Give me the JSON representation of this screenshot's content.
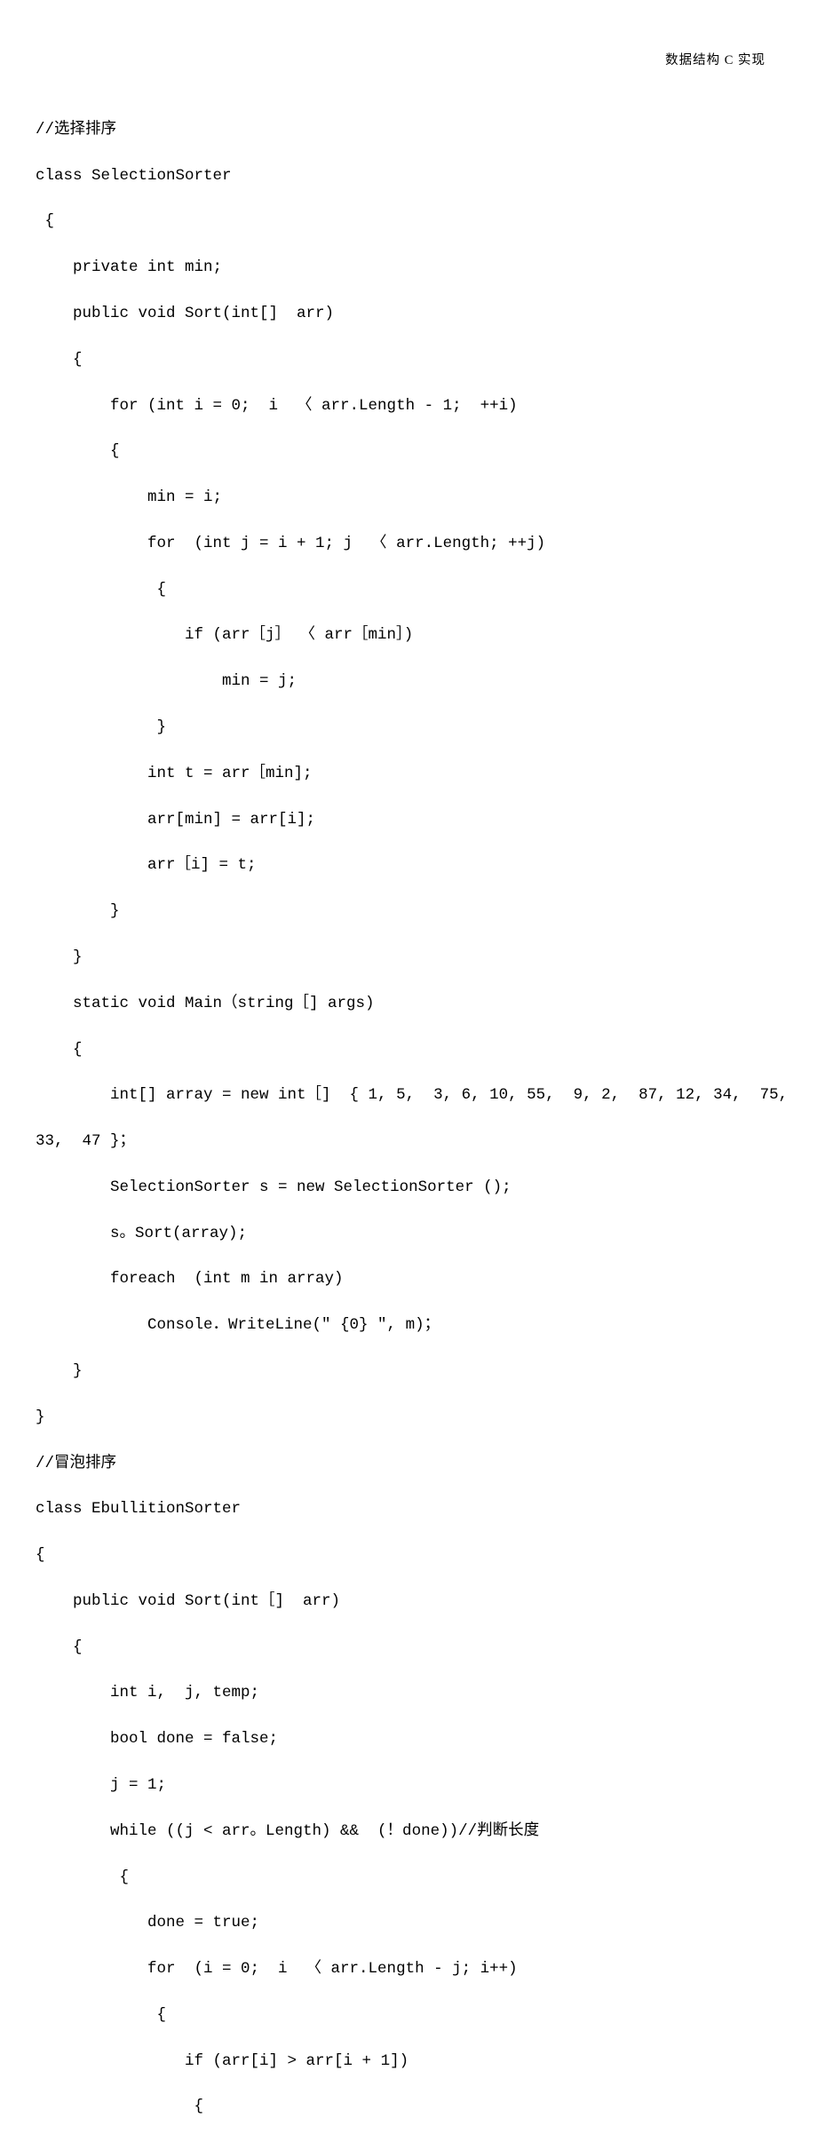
{
  "header": "数据结构 C 实现",
  "code": {
    "l1": "//选择排序",
    "l2": "class SelectionSorter",
    "l3": " {",
    "l4": "    private int min;",
    "l5": "    public void Sort(int[]  arr)",
    "l6": "    {",
    "l7": "        for (int i = 0;  i  〈 arr.Length - 1;  ++i)",
    "l8": "        {",
    "l9": "            min = i;",
    "l10": "            for  (int j = i + 1; j  〈 arr.Length; ++j)",
    "l11": "             {",
    "l12": "                if (arr［j］ 〈 arr［min］)",
    "l13": "                    min = j;",
    "l14": "             }",
    "l15": "            int t = arr［min];",
    "l16": "            arr[min] = arr[i];",
    "l17": "            arr［i] = t;",
    "l18": "        }",
    "l19": "    }",
    "l20": "    static void Main（string［] args)",
    "l21": "    {",
    "l22": "        int[] array = new int［]  { 1, 5,  3, 6, 10, 55,  9, 2,  87, 12, 34,  75,",
    "l23": "33,  47 }；",
    "l24": "        SelectionSorter s = new SelectionSorter ();",
    "l25": "        s。Sort(array);",
    "l26": "        foreach  (int m in array)",
    "l27": "            Console．WriteLine(\" {0} \", m)；",
    "l28": "    }",
    "l29": "}",
    "l30": "//冒泡排序",
    "l31": "class EbullitionSorter",
    "l32": "{",
    "l33": "    public void Sort(int［]  arr)",
    "l34": "    {",
    "l35": "        int i,  j, temp;",
    "l36": "        bool done = false;",
    "l37": "        j = 1;",
    "l38": "        while ((j < arr。Length) &&  (！done))//判断长度",
    "l39": "         {",
    "l40": "            done = true;",
    "l41": "            for  (i = 0;  i  〈 arr.Length - j; i++)",
    "l42": "             {",
    "l43": "                if (arr[i] > arr[i + 1])",
    "l44": "                 {"
  }
}
